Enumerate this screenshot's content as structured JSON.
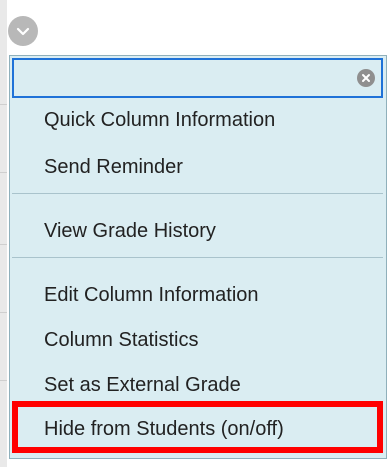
{
  "menu": {
    "groups": [
      {
        "items": [
          "Quick Column Information",
          "Send Reminder"
        ]
      },
      {
        "items": [
          "View Grade History"
        ]
      },
      {
        "items": [
          "Edit Column Information",
          "Column Statistics",
          "Set as External Grade",
          "Hide from Students (on/off)"
        ]
      }
    ],
    "highlighted_item": "Hide from Students (on/off)"
  },
  "icons": {
    "toggle": "chevron-down-icon",
    "close": "close-icon"
  },
  "colors": {
    "menu_background": "#daedf2",
    "focus_border": "#1f72d8",
    "highlight_border": "#ff0000"
  }
}
